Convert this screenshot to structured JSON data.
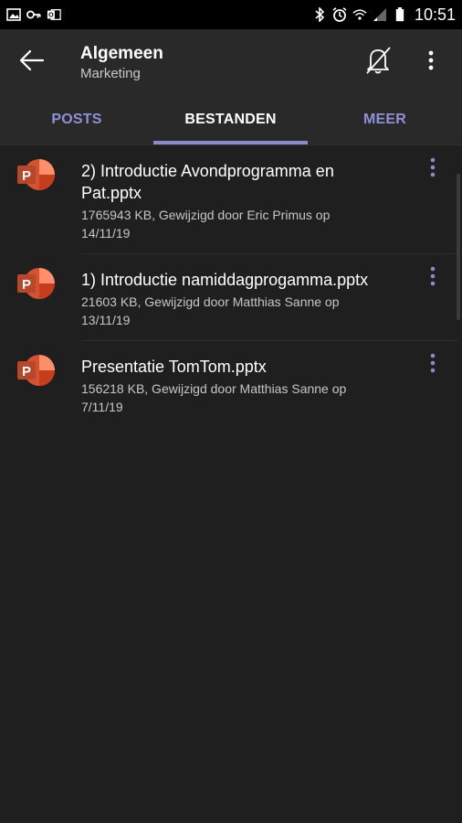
{
  "status_bar": {
    "time": "10:51",
    "left_icons": [
      "image-icon",
      "key-icon",
      "outlook-icon"
    ],
    "right_icons": [
      "bluetooth-icon",
      "alarm-icon",
      "wifi-icon",
      "signal-icon",
      "battery-icon"
    ]
  },
  "header": {
    "title": "Algemeen",
    "subtitle": "Marketing"
  },
  "tabs": [
    {
      "label": "POSTS",
      "active": false
    },
    {
      "label": "BESTANDEN",
      "active": true
    },
    {
      "label": "MEER",
      "active": false
    }
  ],
  "files": [
    {
      "name": "2) Introductie Avondprogramma en Pat.pptx",
      "meta": "1765943 KB, Gewijzigd door Eric Primus op 14/11/19"
    },
    {
      "name": "1) Introductie namiddagprogamma.pptx",
      "meta": "21603 KB, Gewijzigd door Matthias Sanne op 13/11/19"
    },
    {
      "name": "Presentatie TomTom.pptx",
      "meta": "156218 KB, Gewijzigd door Matthias Sanne op 7/11/19"
    }
  ],
  "colors": {
    "accent": "#8b8cc7",
    "background": "#1f1f1f",
    "header": "#292929",
    "powerpoint": "#d35230"
  }
}
